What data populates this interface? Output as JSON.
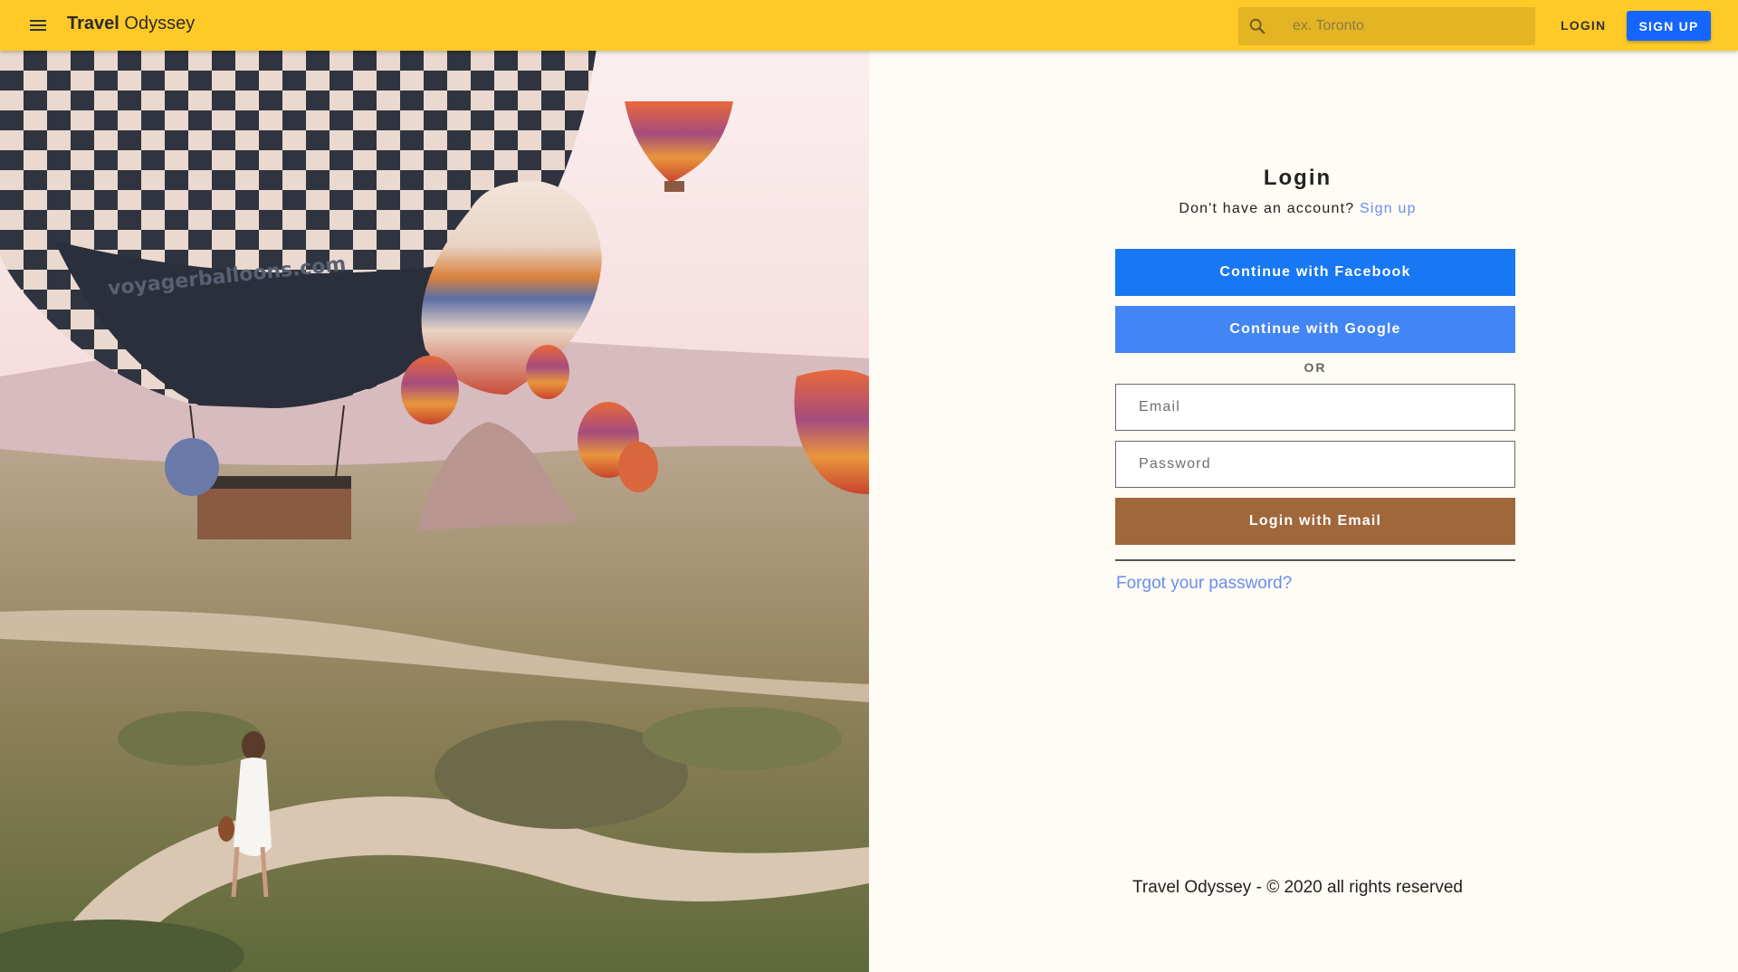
{
  "app": {
    "brand_bold": "Travel",
    "brand_rest": " Odyssey"
  },
  "header": {
    "menu_icon": "hamburger-menu-icon",
    "search_icon": "search-icon",
    "search_placeholder": "ex. Toronto",
    "login_label": "LOGIN",
    "signup_label": "SIGN UP",
    "bar_color": "#ffca28",
    "signup_color": "#1565ff"
  },
  "hero": {
    "balloon_print": "voyagerballoons.com"
  },
  "login": {
    "title": "Login",
    "no_account_text": "Don't have an account?",
    "signup_link": "Sign up",
    "facebook_label": "Continue with Facebook",
    "google_label": "Continue with Google",
    "or_label": "OR",
    "email_placeholder": "Email",
    "password_placeholder": "Password",
    "email_button_label": "Login with Email",
    "forgot_label": "Forgot your password?",
    "facebook_color": "#1877f2",
    "google_color": "#4285f4",
    "email_button_color": "#a0673a",
    "link_color": "#6b8df0"
  },
  "footer": {
    "text": "Travel Odyssey - © 2020 all rights reserved"
  }
}
